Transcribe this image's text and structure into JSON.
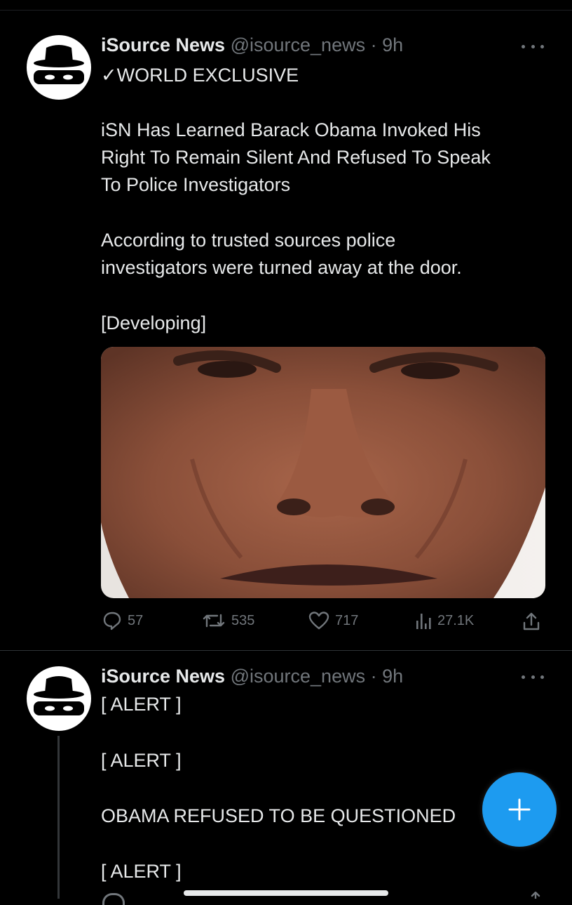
{
  "tweets": [
    {
      "author_name": "iSource News",
      "handle": "@isource_news",
      "separator": "·",
      "time": "9h",
      "lines": [
        "✓WORLD EXCLUSIVE",
        "iSN Has Learned Barack Obama Invoked His",
        "Right To Remain Silent And Refused To Speak",
        "To Police Investigators",
        "According to trusted sources police",
        "investigators were turned away at the door.",
        "[Developing]"
      ],
      "stats": {
        "replies": "57",
        "retweets": "535",
        "likes": "717",
        "views": "27.1K"
      }
    },
    {
      "author_name": "iSource News",
      "handle": "@isource_news",
      "separator": "·",
      "time": "9h",
      "lines": [
        "[ ALERT ]",
        "[ ALERT ]",
        "OBAMA REFUSED TO BE QUESTIONED",
        "[ ALERT ]"
      ]
    }
  ],
  "icons": {
    "avatar": "masked-hat-avatar-icon",
    "more": "more-options-icon",
    "reply": "reply-icon",
    "retweet": "retweet-icon",
    "like": "heart-icon",
    "views": "views-icon",
    "share": "share-icon",
    "compose": "plus-icon"
  },
  "colors": {
    "background": "#000000",
    "text": "#e7e9ea",
    "muted": "#71767b",
    "accent": "#1d9bf0"
  }
}
